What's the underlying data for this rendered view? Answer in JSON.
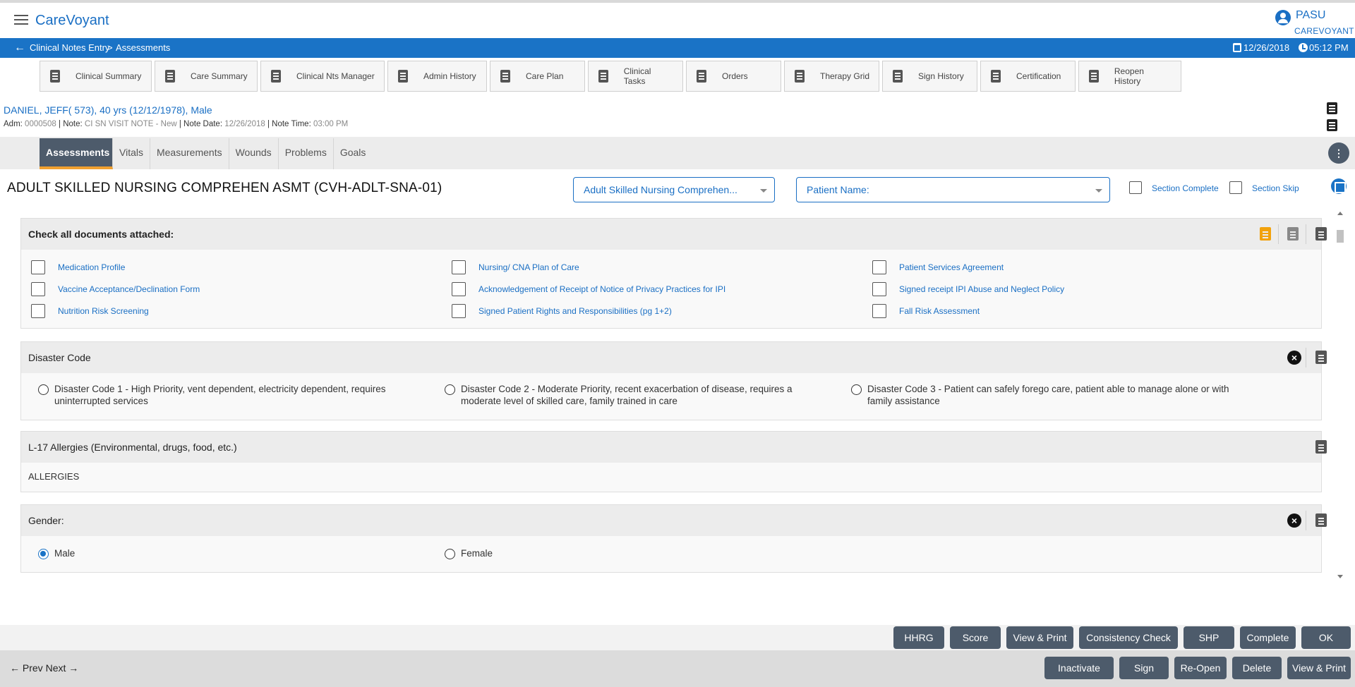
{
  "app": {
    "brand": "CareVoyant",
    "user_name": "PASU",
    "user_org": "CAREVOYANT"
  },
  "breadcrumb": {
    "items": [
      "Clinical Notes Entry",
      "Assessments"
    ],
    "separator": ">",
    "date": "12/26/2018",
    "time": "05:12 PM"
  },
  "nav_tabs": [
    "Clinical Summary",
    "Care Summary",
    "Clinical Nts Manager",
    "Admin History",
    "Care Plan",
    "Clinical Tasks",
    "Orders",
    "Therapy Grid",
    "Sign History",
    "Certification",
    "Reopen History"
  ],
  "patient": {
    "header": "DANIEL, JEFF( 573), 40 yrs (12/12/1978), Male",
    "adm_label": "Adm: ",
    "adm_value": "0000508",
    "note_label": " | Note: ",
    "note_value": "CI SN VISIT NOTE - New",
    "note_date_label": " | Note Date: ",
    "note_date_value": "12/26/2018",
    "note_time_label": " | Note Time: ",
    "note_time_value": "03:00 PM"
  },
  "sub_tabs": [
    "Assessments",
    "Vitals",
    "Measurements",
    "Wounds",
    "Problems",
    "Goals"
  ],
  "active_sub_tab": "Assessments",
  "form": {
    "title": "ADULT SKILLED NURSING COMPREHEN ASMT (CVH-ADLT-SNA-01)",
    "form_select": "Adult Skilled Nursing Comprehen...",
    "patient_name_select": "Patient Name:",
    "section_complete": "Section Complete",
    "section_skip": "Section Skip"
  },
  "sections": {
    "documents": {
      "title": "Check all documents attached:",
      "items": [
        "Medication Profile",
        "Nursing/ CNA Plan of Care",
        "Patient Services Agreement",
        "Vaccine Acceptance/Declination Form",
        "Acknowledgement of Receipt of Notice of Privacy Practices for IPI",
        "Signed receipt IPI Abuse and Neglect Policy",
        "Nutrition Risk Screening",
        "Signed Patient Rights and Responsibilities (pg 1+2)",
        "Fall Risk Assessment"
      ]
    },
    "disaster": {
      "title": "Disaster Code",
      "options": [
        "Disaster Code 1 - High Priority, vent dependent, electricity dependent, requires uninterrupted services",
        "Disaster Code 2 - Moderate Priority, recent exacerbation of disease, requires a moderate level of skilled care, family trained in care",
        "Disaster Code 3 - Patient can safely forego care, patient able to manage alone or with family assistance"
      ]
    },
    "allergies": {
      "title": "L-17 Allergies (Environmental, drugs, food, etc.)",
      "value": "ALLERGIES"
    },
    "gender": {
      "title": "Gender:",
      "options": [
        "Male",
        "Female"
      ],
      "selected": "Male"
    }
  },
  "action_buttons": [
    "HHRG",
    "Score",
    "View & Print",
    "Consistency Check",
    "SHP",
    "Complete",
    "OK"
  ],
  "footer": {
    "prev": "Prev",
    "next": "Next",
    "buttons": [
      "Inactivate",
      "Sign",
      "Re-Open",
      "Delete",
      "View & Print"
    ]
  },
  "colors": {
    "brand_blue": "#1a73c6",
    "button_slate": "#4d5b6b",
    "active_tab_accent": "#f0a030",
    "doc_orange": "#f2a20c"
  }
}
